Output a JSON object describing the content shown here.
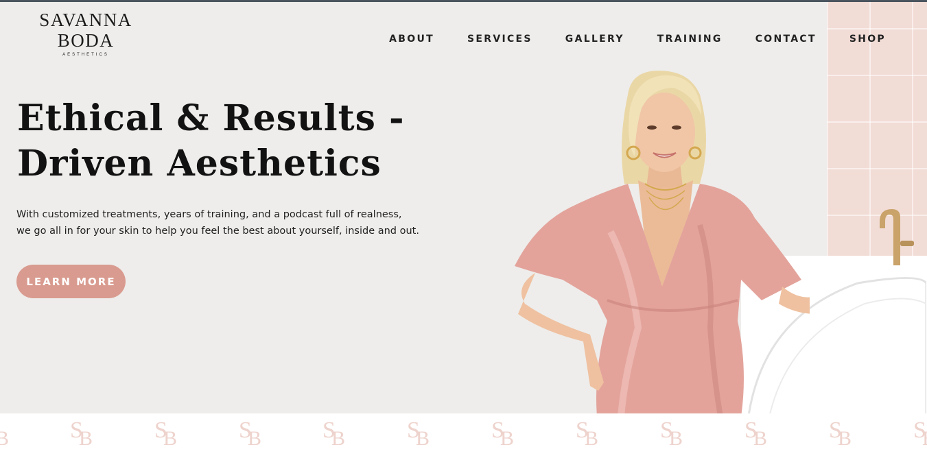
{
  "logo": {
    "line1": "SAVANNA",
    "line2": "BODA",
    "sub": "AESTHETICS"
  },
  "nav": {
    "items": [
      "ABOUT",
      "SERVICES",
      "GALLERY",
      "TRAINING",
      "CONTACT",
      "SHOP"
    ]
  },
  "hero": {
    "headline_line1": "Ethical & Results -",
    "headline_line2": "Driven Aesthetics",
    "lead_line1": "With customized treatments, years of training, and a podcast full of realness,",
    "lead_line2": "we go all in for your skin to help you feel the best about yourself, inside and out.",
    "cta_label": "LEARN MORE"
  },
  "pattern": {
    "monogram_s": "S",
    "monogram_b": "B"
  },
  "colors": {
    "accent": "#d99b8f",
    "hero_bg": "#eeedeb",
    "dress": "#e3a39b",
    "monogram": "#eed3cd"
  }
}
